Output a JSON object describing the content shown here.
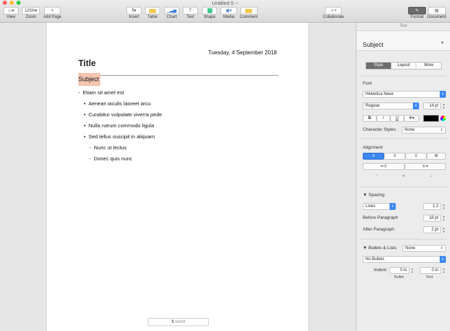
{
  "window": {
    "title": "Untitled 5 ~"
  },
  "toolbar": {
    "view": "View",
    "zoom": "Zoom",
    "zoom_value": "125%",
    "add_page": "Add Page",
    "insert": "Insert",
    "table": "Table",
    "chart": "Chart",
    "text": "Text",
    "shape": "Shape",
    "media": "Media",
    "comment": "Comment",
    "collaborate": "Collaborate",
    "format": "Format",
    "document": "Document"
  },
  "document": {
    "date": "Tuesday, 4 September 2018",
    "title": "Title",
    "subject": "Subject",
    "bullets": [
      {
        "level": 1,
        "marker": "-",
        "text": "Etiam sit amet est"
      },
      {
        "level": 2,
        "marker": "•",
        "text": "Aenean iaculis laoreet arcu"
      },
      {
        "level": 2,
        "marker": "•",
        "text": "Curabitur vulputate viverra pede"
      },
      {
        "level": 2,
        "marker": "•",
        "text": "Nulla rutrum commodo ligula"
      },
      {
        "level": 2,
        "marker": "•",
        "text": "Sed tellus suscipit in aliquam"
      },
      {
        "level": 3,
        "marker": "-",
        "text": "Nunc ut lectus"
      },
      {
        "level": 3,
        "marker": "-",
        "text": "Donec quis nunc"
      }
    ],
    "word_count": "1",
    "word_label": "word"
  },
  "inspector": {
    "header": "Text",
    "style_name": "Subject",
    "tabs": [
      "Style",
      "Layout",
      "More"
    ],
    "font_label": "Font",
    "font_family": "Helvetica Neue",
    "font_style": "Regular",
    "font_size": "14 pt",
    "char_styles_label": "Character Styles",
    "char_styles_value": "None",
    "alignment_label": "Alignment",
    "spacing_label": "Spacing",
    "spacing_mode": "Lines",
    "spacing_value": "1.2",
    "before_label": "Before Paragraph",
    "before_value": "18 pt",
    "after_label": "After Paragraph",
    "after_value": "2 pt",
    "bullets_label": "Bullets & Lists",
    "bullets_value": "None",
    "bullets_type": "No Bullets",
    "indent_label": "Indent:",
    "bullet_indent": "0 in",
    "text_indent": "0 in",
    "bullet_caption": "Bullet",
    "text_caption": "Text"
  }
}
